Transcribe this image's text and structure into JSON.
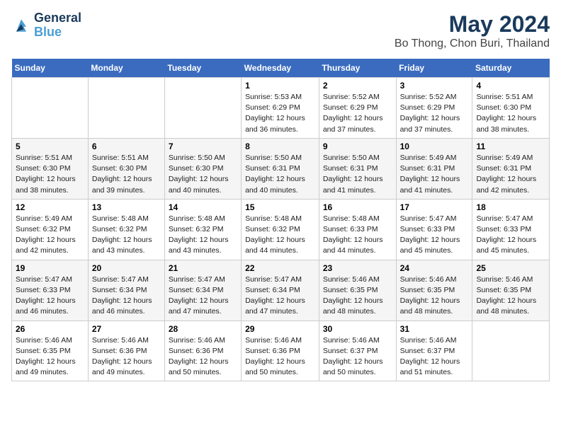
{
  "header": {
    "logo_line1": "General",
    "logo_line2": "Blue",
    "title": "May 2024",
    "subtitle": "Bo Thong, Chon Buri, Thailand"
  },
  "calendar": {
    "days_of_week": [
      "Sunday",
      "Monday",
      "Tuesday",
      "Wednesday",
      "Thursday",
      "Friday",
      "Saturday"
    ],
    "weeks": [
      [
        {
          "day": "",
          "info": ""
        },
        {
          "day": "",
          "info": ""
        },
        {
          "day": "",
          "info": ""
        },
        {
          "day": "1",
          "info": "Sunrise: 5:53 AM\nSunset: 6:29 PM\nDaylight: 12 hours and 36 minutes."
        },
        {
          "day": "2",
          "info": "Sunrise: 5:52 AM\nSunset: 6:29 PM\nDaylight: 12 hours and 37 minutes."
        },
        {
          "day": "3",
          "info": "Sunrise: 5:52 AM\nSunset: 6:29 PM\nDaylight: 12 hours and 37 minutes."
        },
        {
          "day": "4",
          "info": "Sunrise: 5:51 AM\nSunset: 6:30 PM\nDaylight: 12 hours and 38 minutes."
        }
      ],
      [
        {
          "day": "5",
          "info": "Sunrise: 5:51 AM\nSunset: 6:30 PM\nDaylight: 12 hours and 38 minutes."
        },
        {
          "day": "6",
          "info": "Sunrise: 5:51 AM\nSunset: 6:30 PM\nDaylight: 12 hours and 39 minutes."
        },
        {
          "day": "7",
          "info": "Sunrise: 5:50 AM\nSunset: 6:30 PM\nDaylight: 12 hours and 40 minutes."
        },
        {
          "day": "8",
          "info": "Sunrise: 5:50 AM\nSunset: 6:31 PM\nDaylight: 12 hours and 40 minutes."
        },
        {
          "day": "9",
          "info": "Sunrise: 5:50 AM\nSunset: 6:31 PM\nDaylight: 12 hours and 41 minutes."
        },
        {
          "day": "10",
          "info": "Sunrise: 5:49 AM\nSunset: 6:31 PM\nDaylight: 12 hours and 41 minutes."
        },
        {
          "day": "11",
          "info": "Sunrise: 5:49 AM\nSunset: 6:31 PM\nDaylight: 12 hours and 42 minutes."
        }
      ],
      [
        {
          "day": "12",
          "info": "Sunrise: 5:49 AM\nSunset: 6:32 PM\nDaylight: 12 hours and 42 minutes."
        },
        {
          "day": "13",
          "info": "Sunrise: 5:48 AM\nSunset: 6:32 PM\nDaylight: 12 hours and 43 minutes."
        },
        {
          "day": "14",
          "info": "Sunrise: 5:48 AM\nSunset: 6:32 PM\nDaylight: 12 hours and 43 minutes."
        },
        {
          "day": "15",
          "info": "Sunrise: 5:48 AM\nSunset: 6:32 PM\nDaylight: 12 hours and 44 minutes."
        },
        {
          "day": "16",
          "info": "Sunrise: 5:48 AM\nSunset: 6:33 PM\nDaylight: 12 hours and 44 minutes."
        },
        {
          "day": "17",
          "info": "Sunrise: 5:47 AM\nSunset: 6:33 PM\nDaylight: 12 hours and 45 minutes."
        },
        {
          "day": "18",
          "info": "Sunrise: 5:47 AM\nSunset: 6:33 PM\nDaylight: 12 hours and 45 minutes."
        }
      ],
      [
        {
          "day": "19",
          "info": "Sunrise: 5:47 AM\nSunset: 6:33 PM\nDaylight: 12 hours and 46 minutes."
        },
        {
          "day": "20",
          "info": "Sunrise: 5:47 AM\nSunset: 6:34 PM\nDaylight: 12 hours and 46 minutes."
        },
        {
          "day": "21",
          "info": "Sunrise: 5:47 AM\nSunset: 6:34 PM\nDaylight: 12 hours and 47 minutes."
        },
        {
          "day": "22",
          "info": "Sunrise: 5:47 AM\nSunset: 6:34 PM\nDaylight: 12 hours and 47 minutes."
        },
        {
          "day": "23",
          "info": "Sunrise: 5:46 AM\nSunset: 6:35 PM\nDaylight: 12 hours and 48 minutes."
        },
        {
          "day": "24",
          "info": "Sunrise: 5:46 AM\nSunset: 6:35 PM\nDaylight: 12 hours and 48 minutes."
        },
        {
          "day": "25",
          "info": "Sunrise: 5:46 AM\nSunset: 6:35 PM\nDaylight: 12 hours and 48 minutes."
        }
      ],
      [
        {
          "day": "26",
          "info": "Sunrise: 5:46 AM\nSunset: 6:35 PM\nDaylight: 12 hours and 49 minutes."
        },
        {
          "day": "27",
          "info": "Sunrise: 5:46 AM\nSunset: 6:36 PM\nDaylight: 12 hours and 49 minutes."
        },
        {
          "day": "28",
          "info": "Sunrise: 5:46 AM\nSunset: 6:36 PM\nDaylight: 12 hours and 50 minutes."
        },
        {
          "day": "29",
          "info": "Sunrise: 5:46 AM\nSunset: 6:36 PM\nDaylight: 12 hours and 50 minutes."
        },
        {
          "day": "30",
          "info": "Sunrise: 5:46 AM\nSunset: 6:37 PM\nDaylight: 12 hours and 50 minutes."
        },
        {
          "day": "31",
          "info": "Sunrise: 5:46 AM\nSunset: 6:37 PM\nDaylight: 12 hours and 51 minutes."
        },
        {
          "day": "",
          "info": ""
        }
      ]
    ]
  }
}
